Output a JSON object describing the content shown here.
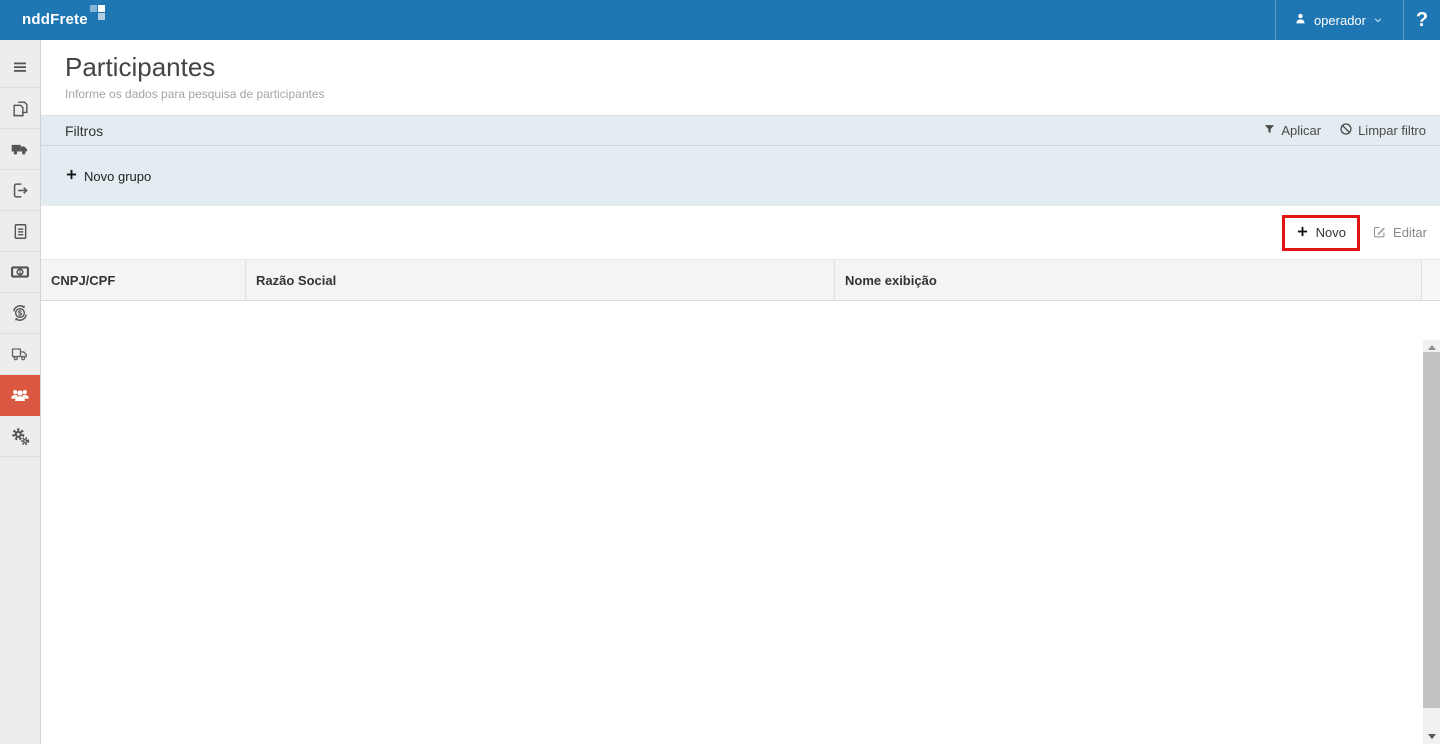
{
  "topbar": {
    "logo_text": "nddFrete",
    "user_label": "operador",
    "help_label": "?"
  },
  "page": {
    "title": "Participantes",
    "subtitle": "Informe os dados para pesquisa de participantes"
  },
  "filters": {
    "title": "Filtros",
    "apply_label": "Aplicar",
    "clear_label": "Limpar filtro",
    "new_group_label": "Novo grupo"
  },
  "actions": {
    "new_label": "Novo",
    "edit_label": "Editar"
  },
  "table": {
    "columns": [
      "CNPJ/CPF",
      "Razão Social",
      "Nome exibição"
    ],
    "rows": []
  },
  "sidebar": {
    "icons": [
      "menu-icon",
      "copy-icon",
      "truck-icon",
      "export-icon",
      "document-icon",
      "money-icon",
      "currency-exchange-icon",
      "delivery-truck-icon",
      "participants-icon",
      "settings-icon"
    ],
    "active_item": "participants-icon",
    "active_index": 8
  },
  "colors": {
    "topbar_blue": "#1e76b2",
    "active_item_orange": "#da5742",
    "highlight_red": "#e01414",
    "filter_panel_bg": "#e2ecf1"
  }
}
